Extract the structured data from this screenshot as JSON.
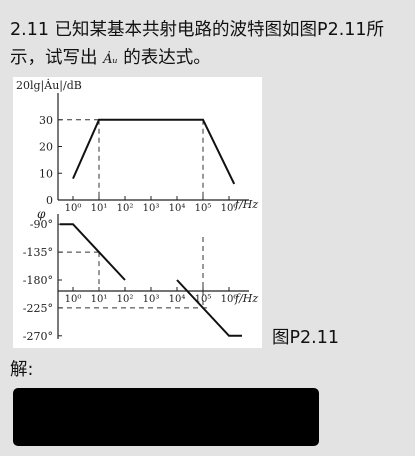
{
  "problem": {
    "line1": "2.11 已知某基本共射电路的波特图如图P2.11所",
    "line2_a": "示，试写出",
    "line2_symbol": "Ȧᵤ",
    "line2_b": "的表达式。"
  },
  "figure_caption": "图P2.11",
  "answer_label": "解:",
  "chart_data": [
    {
      "type": "line",
      "title": "",
      "ylabel": "20lg|Ȧu|/dB",
      "xlabel": "f/Hz",
      "x_scale": "log",
      "x_tick_labels": [
        "10⁰",
        "10¹",
        "10²",
        "10³",
        "10⁴",
        "10⁵",
        "10⁶"
      ],
      "y_tick_labels": [
        "10",
        "20",
        "30"
      ],
      "ylim": [
        0,
        40
      ],
      "series": [
        {
          "x": [
            0,
            1,
            5,
            6.2
          ],
          "y": [
            8,
            30,
            30,
            6
          ]
        }
      ]
    },
    {
      "type": "line",
      "title": "",
      "ylabel": "φ",
      "xlabel": "f/Hz",
      "x_scale": "log",
      "x_tick_labels": [
        "10⁰",
        "10¹",
        "10²",
        "10³",
        "10⁴",
        "10⁵",
        "10⁶"
      ],
      "y_tick_labels": [
        "-90°",
        "-135°",
        "-180°",
        "-225°",
        "-270°"
      ],
      "ylim": [
        -280,
        -80
      ],
      "series": [
        {
          "x": [
            -0.5,
            0,
            2
          ],
          "y": [
            -90,
            -90,
            -180
          ]
        },
        {
          "x": [
            4,
            6,
            6.5
          ],
          "y": [
            -180,
            -270,
            -270
          ]
        }
      ]
    }
  ]
}
